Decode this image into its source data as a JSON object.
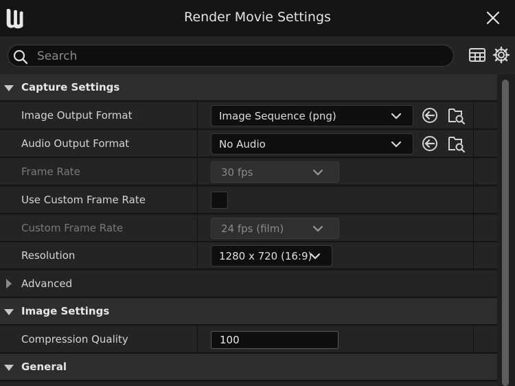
{
  "window": {
    "title": "Render Movie Settings",
    "logo": "unreal-logo",
    "close_icon": "close-icon"
  },
  "toolbar": {
    "search_placeholder": "Search",
    "table_icon": "table-view-icon",
    "settings_icon": "gear-icon"
  },
  "sections": {
    "capture": {
      "title": "Capture Settings",
      "image_output_format": {
        "label": "Image Output Format",
        "value": "Image Sequence (png)"
      },
      "audio_output_format": {
        "label": "Audio Output Format",
        "value": "No Audio"
      },
      "frame_rate": {
        "label": "Frame Rate",
        "value": "30 fps",
        "enabled": false
      },
      "use_custom_frame_rate": {
        "label": "Use Custom Frame Rate",
        "checked": false
      },
      "custom_frame_rate": {
        "label": "Custom Frame Rate",
        "value": "24 fps (film)",
        "enabled": false
      },
      "resolution": {
        "label": "Resolution",
        "value": "1280 x 720 (16:9)"
      },
      "advanced": {
        "label": "Advanced",
        "expanded": false
      }
    },
    "image": {
      "title": "Image Settings",
      "compression_quality": {
        "label": "Compression Quality",
        "value": "100"
      }
    },
    "general": {
      "title": "General"
    }
  },
  "icons": {
    "reset": "reset-to-default-icon",
    "browse": "browse-folder-icon",
    "chevron": "chevron-down-icon",
    "caret_down": "caret-down-icon",
    "caret_right": "caret-right-icon"
  }
}
